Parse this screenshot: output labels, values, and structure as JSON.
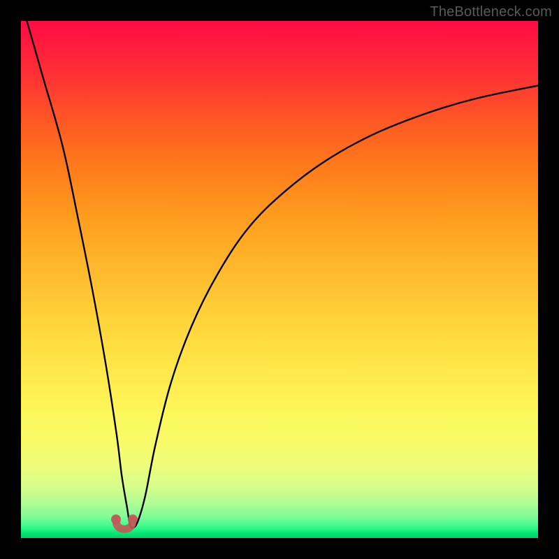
{
  "watermark": "TheBottleneck.com",
  "chart_data": {
    "type": "line",
    "title": "",
    "xlabel": "",
    "ylabel": "",
    "xlim": [
      0,
      100
    ],
    "ylim": [
      0,
      100
    ],
    "grid": false,
    "series": [
      {
        "name": "curve",
        "x": [
          0,
          4,
          8,
          11,
          14,
          16.5,
          18.5,
          19.5,
          20.5,
          21.0,
          21.5,
          22.5,
          24,
          26,
          29,
          33,
          38,
          44,
          51,
          59,
          68,
          78,
          88,
          100
        ],
        "values": [
          104,
          90,
          76,
          62,
          47,
          33,
          20,
          12,
          6,
          3,
          2,
          3,
          8,
          18,
          30,
          41,
          51,
          60,
          67,
          73,
          78,
          82,
          85,
          87.5
        ]
      }
    ],
    "marker": {
      "x": 20,
      "y": 2,
      "label": ""
    },
    "colors": {
      "curve": "#000000",
      "marker": "#c15a57",
      "gradient_top": "#ff0b44",
      "gradient_bottom": "#04cf67"
    }
  }
}
